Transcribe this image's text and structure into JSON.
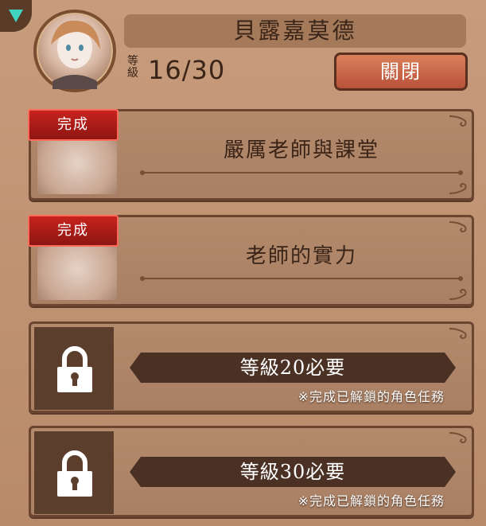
{
  "header": {
    "character_name": "貝露嘉莫德",
    "level_label": "等級",
    "level_value": "16/30",
    "close_label": "關閉"
  },
  "quests": [
    {
      "status_badge": "完成",
      "title": "嚴厲老師與課堂"
    },
    {
      "status_badge": "完成",
      "title": "老師的實力"
    }
  ],
  "locked": [
    {
      "requirement": "等級20必要",
      "note": "※完成已解鎖的角色任務"
    },
    {
      "requirement": "等級30必要",
      "note": "※完成已解鎖的角色任務"
    }
  ],
  "icons": {
    "collapse": "chevron-down-icon",
    "lock": "lock-icon"
  },
  "colors": {
    "badge_red": "#c8231d",
    "close_button": "#c9643f",
    "panel": "#c19676"
  }
}
